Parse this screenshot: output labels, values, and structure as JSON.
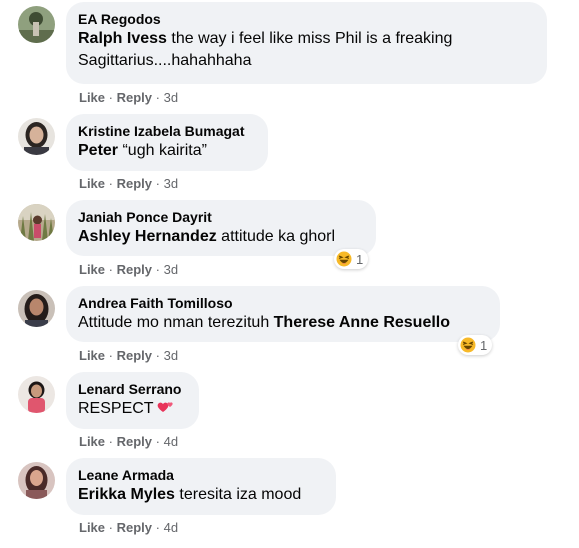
{
  "colors": {
    "bubble_bg": "#f0f2f5",
    "action_text": "#65676b",
    "body_text": "#050505",
    "haha_yellow": "#f7b928"
  },
  "comments": [
    {
      "author": "EA Regodos",
      "tag": "Ralph Ivess",
      "text": " the way i feel like miss Phil is a freaking Sagittarius....hahahhaha",
      "like": "Like",
      "reply": "Reply",
      "dot1": "·",
      "dot2": "·",
      "time": "3d"
    },
    {
      "author": "Kristine Izabela Bumagat",
      "tag": "Peter",
      "text": " “ugh kairita”",
      "like": "Like",
      "reply": "Reply",
      "dot1": "·",
      "dot2": "·",
      "time": "3d"
    },
    {
      "author": "Janiah Ponce Dayrit",
      "tag": "Ashley Hernandez",
      "text": " attitude ka ghorl",
      "reaction_icon": "haha-emoji-icon",
      "reaction_count": "1",
      "like": "Like",
      "reply": "Reply",
      "dot1": "·",
      "dot2": "·",
      "time": "3d"
    },
    {
      "author": "Andrea Faith Tomilloso",
      "text_before": "Attitude mo nman terezituh ",
      "tag": "Therese Anne Resuello",
      "reaction_icon": "haha-emoji-icon",
      "reaction_count": "1",
      "like": "Like",
      "reply": "Reply",
      "dot1": "·",
      "dot2": "·",
      "time": "3d"
    },
    {
      "author": "Lenard Serrano",
      "text": "RESPECT",
      "inline_icon": "two-hearts-icon",
      "like": "Like",
      "reply": "Reply",
      "dot1": "·",
      "dot2": "·",
      "time": "4d"
    },
    {
      "author": "Leane Armada",
      "tag": "Erikka Myles",
      "text": " teresita iza mood",
      "like": "Like",
      "reply": "Reply",
      "dot1": "·",
      "dot2": "·",
      "time": "4d"
    }
  ]
}
